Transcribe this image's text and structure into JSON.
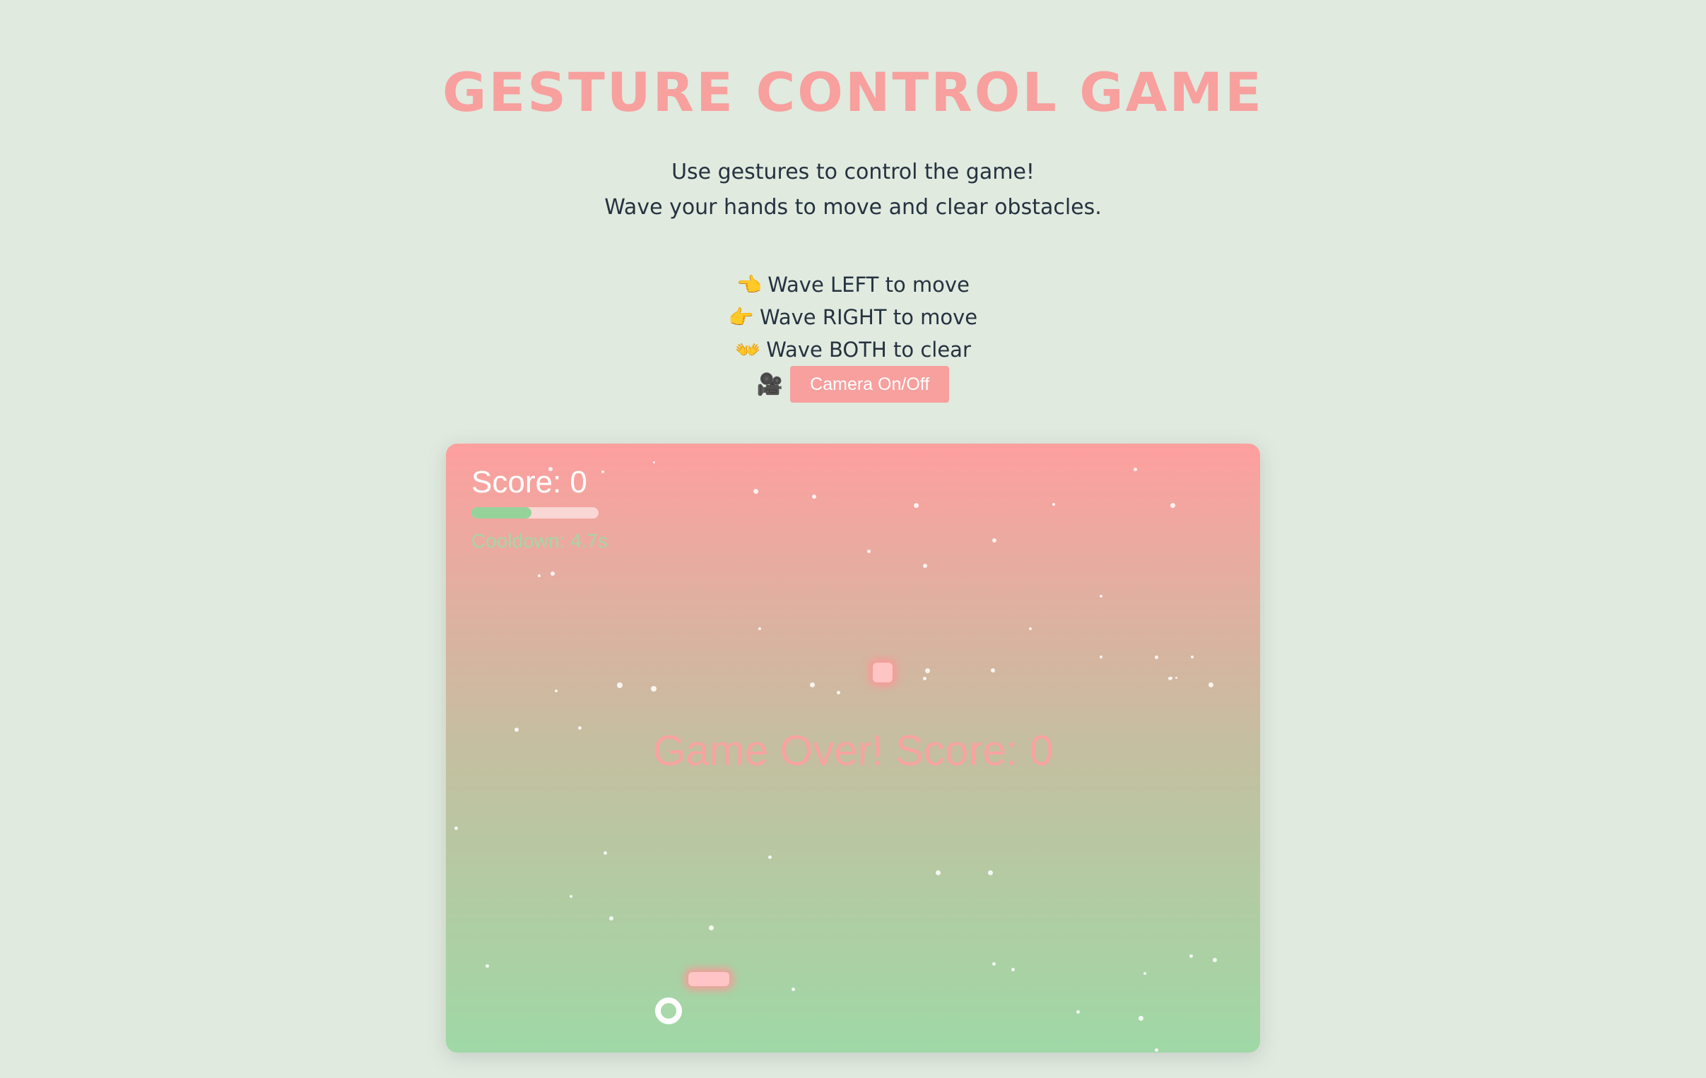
{
  "header": {
    "title": "GESTURE CONTROL GAME",
    "subtitle_line1": "Use gestures to control the game!",
    "subtitle_line2": "Wave your hands to move and clear obstacles."
  },
  "instructions": [
    {
      "icon": "👈",
      "icon_name": "point-left-icon",
      "text": "Wave LEFT to move"
    },
    {
      "icon": "👉",
      "icon_name": "point-right-icon",
      "text": "Wave RIGHT to move"
    },
    {
      "icon": "👐",
      "icon_name": "open-hands-icon",
      "text": "Wave BOTH to clear"
    }
  ],
  "camera": {
    "icon": "🎥",
    "icon_name": "camera-icon",
    "button_label": "Camera On/Off"
  },
  "game": {
    "score_text": "Score: 0",
    "cooldown_text": "Cooldown: 4.7s",
    "cooldown_progress": 0.47,
    "game_over_text": "Game Over! Score: 0"
  },
  "colors": {
    "background": "#e0eadf",
    "accent": "#f7a09e",
    "game_top": "#fe9f9f",
    "game_bottom": "#9fd8a6",
    "cooldown_green": "#96d39b"
  }
}
